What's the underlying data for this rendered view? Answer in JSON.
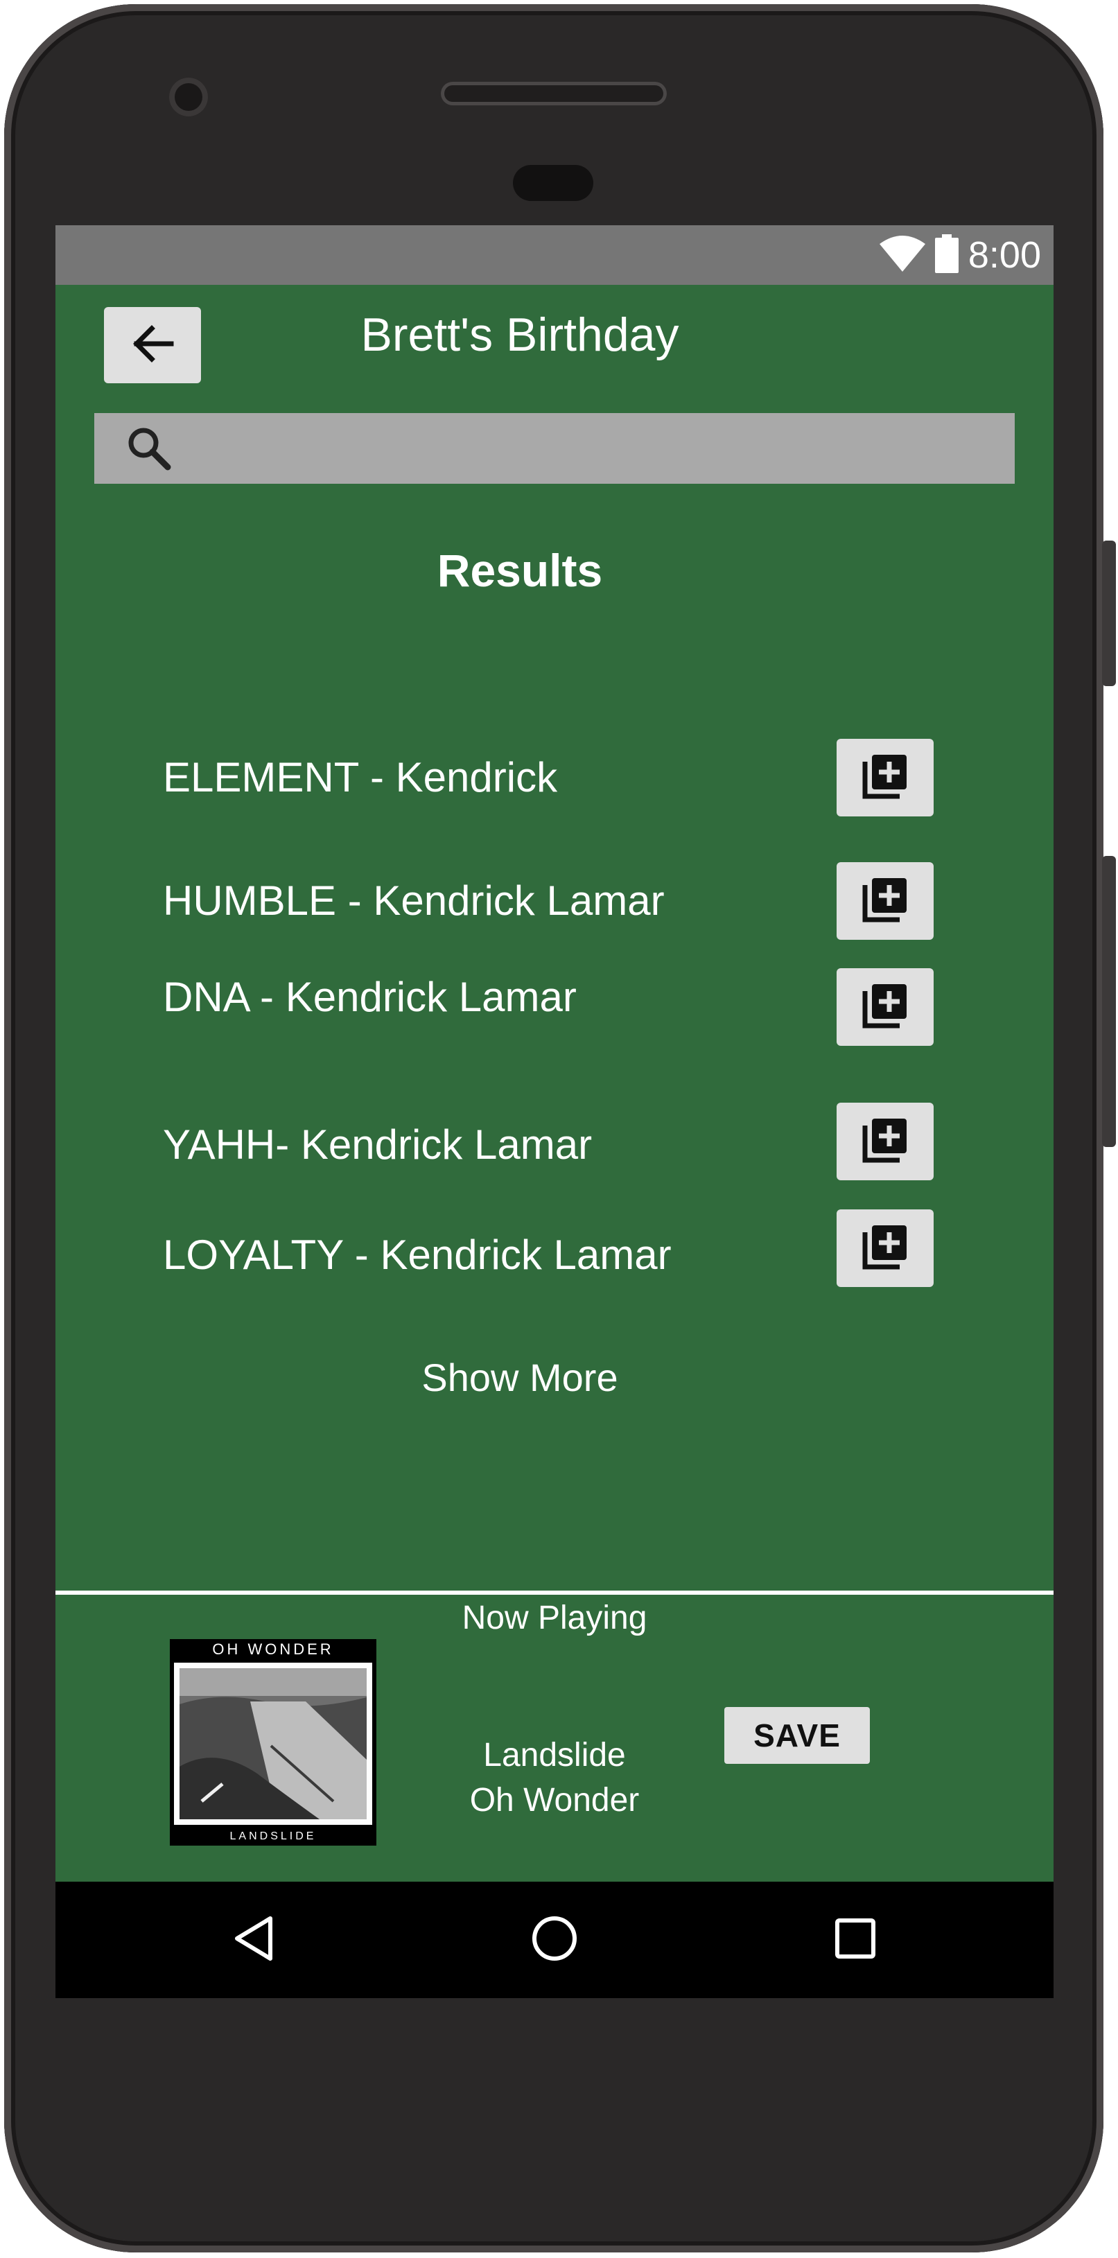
{
  "status_bar": {
    "time": "8:00",
    "wifi_icon": "wifi-icon",
    "battery_icon": "battery-icon"
  },
  "header": {
    "back_icon": "arrow-left-icon",
    "title": "Brett's Birthday"
  },
  "search": {
    "icon": "search-icon",
    "value": ""
  },
  "results": {
    "heading": "Results",
    "items": [
      {
        "label": "ELEMENT - Kendrick",
        "action_icon": "add-to-playlist-icon"
      },
      {
        "label": "HUMBLE - Kendrick Lamar",
        "action_icon": "add-to-playlist-icon"
      },
      {
        "label": "DNA - Kendrick Lamar",
        "action_icon": "add-to-playlist-icon"
      },
      {
        "label": "YAHH- Kendrick Lamar",
        "action_icon": "add-to-playlist-icon"
      },
      {
        "label": "LOYALTY - Kendrick Lamar",
        "action_icon": "add-to-playlist-icon"
      }
    ],
    "show_more": "Show More"
  },
  "now_playing": {
    "heading": "Now Playing",
    "album_art": {
      "top_text": "OH WONDER",
      "bottom_text": "LANDSLIDE"
    },
    "track_title": "Landslide",
    "track_artist": "Oh Wonder",
    "save_label": "SAVE"
  },
  "nav_bar": {
    "back_icon": "triangle-back-icon",
    "home_icon": "circle-home-icon",
    "recents_icon": "square-recents-icon"
  },
  "colors": {
    "app_background": "#306b3c",
    "status_bar": "#767676",
    "button": "#e0e0e0",
    "search_bar": "#a9a9a9"
  }
}
